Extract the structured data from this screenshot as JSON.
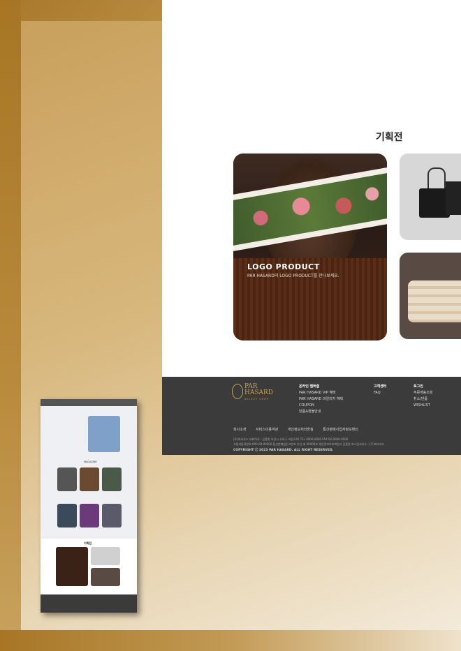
{
  "section": {
    "title": "기획전"
  },
  "main_card": {
    "title": "LOGO PRODUCT",
    "subtitle": "PAR HASARD의 LOGO PRODUCT를 만나보세요."
  },
  "footer": {
    "logo": {
      "name": "PAR HASARD",
      "tagline": "SELECT SHOP"
    },
    "columns": [
      {
        "heading": "온라인 멤버쉽",
        "items": [
          "PAR HASARD VIP 혜택",
          "PAR HASARD 마일리지 혜택",
          "COUPON",
          "반품&환불안내"
        ]
      },
      {
        "heading": "고객센터",
        "items": [
          "FAQ"
        ]
      },
      {
        "heading": "로그인",
        "items": [
          "주문배송조회",
          "취소/반품",
          "WISHLIST"
        ]
      }
    ],
    "links": [
      "회사소개",
      "서비스이용약관",
      "개인정보처리방침",
      "통신판매사업자정보확인"
    ],
    "info_line1": "(주)파라사드    대표이사 : 김종원    부산시 사하구 비동로42    TEL 0000-0000    FAX 00-0000-0000",
    "info_line2": "사업자등록번호 000-00-00000    통신판매업신고번호 부산 제 00000호    개인정보보호책임자 김종원    호스팅서비스 : (주)파라사드",
    "copyright": "COPYRIGHT ⓒ 2023 PAR HASARD. ALL RIGHT RESERVED."
  },
  "thumbnail": {
    "magazine_label": "MAGAZINE",
    "promo_label": "기획전"
  },
  "colors": {
    "accent": "#c9a050",
    "footer_bg": "#3b3b3b",
    "frame_gold": "#a8782a"
  }
}
